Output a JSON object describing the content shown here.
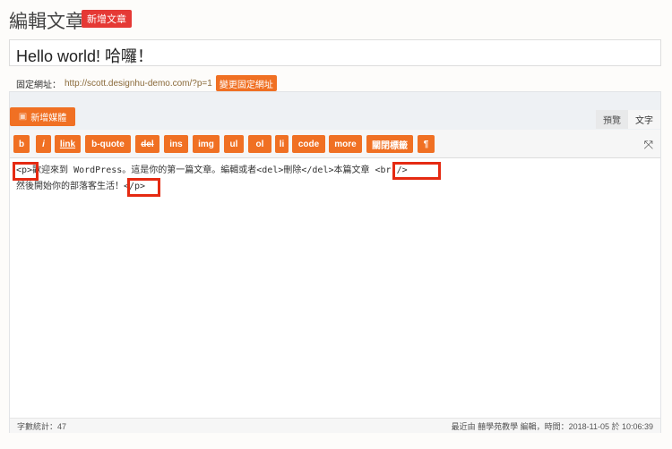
{
  "header": {
    "title": "編輯文章",
    "add_new": "新增文章"
  },
  "post": {
    "title": "Hello world! 哈囉！"
  },
  "permalink": {
    "label": "固定網址：",
    "url": "http://scott.designhu-demo.com/?p=1",
    "change": "變更固定網址"
  },
  "editor": {
    "add_media": "新增媒體",
    "tabs": [
      {
        "label": "預覽",
        "active": false
      },
      {
        "label": "文字",
        "active": true
      }
    ],
    "quicktags": [
      "b",
      "i",
      "link",
      "b-quote",
      "del",
      "ins",
      "img",
      "ul",
      "ol",
      "li",
      "code",
      "more",
      "關閉標籤",
      "¶"
    ],
    "content_lines": [
      "<p>歡迎來到 WordPress。這是你的第一篇文章。編輯或者<del>刪除</del>本篇文章 <br />",
      "然後開始你的部落客生活！</p>"
    ],
    "highlight_color": "#e52a12"
  },
  "footer": {
    "word_count": "字數統計：47",
    "last_edited": "最近由 囍學苑教學 編輯，時間：2018-11-05 於 10:06:39"
  },
  "colors": {
    "accent": "#f07023",
    "danger": "#e53935"
  }
}
